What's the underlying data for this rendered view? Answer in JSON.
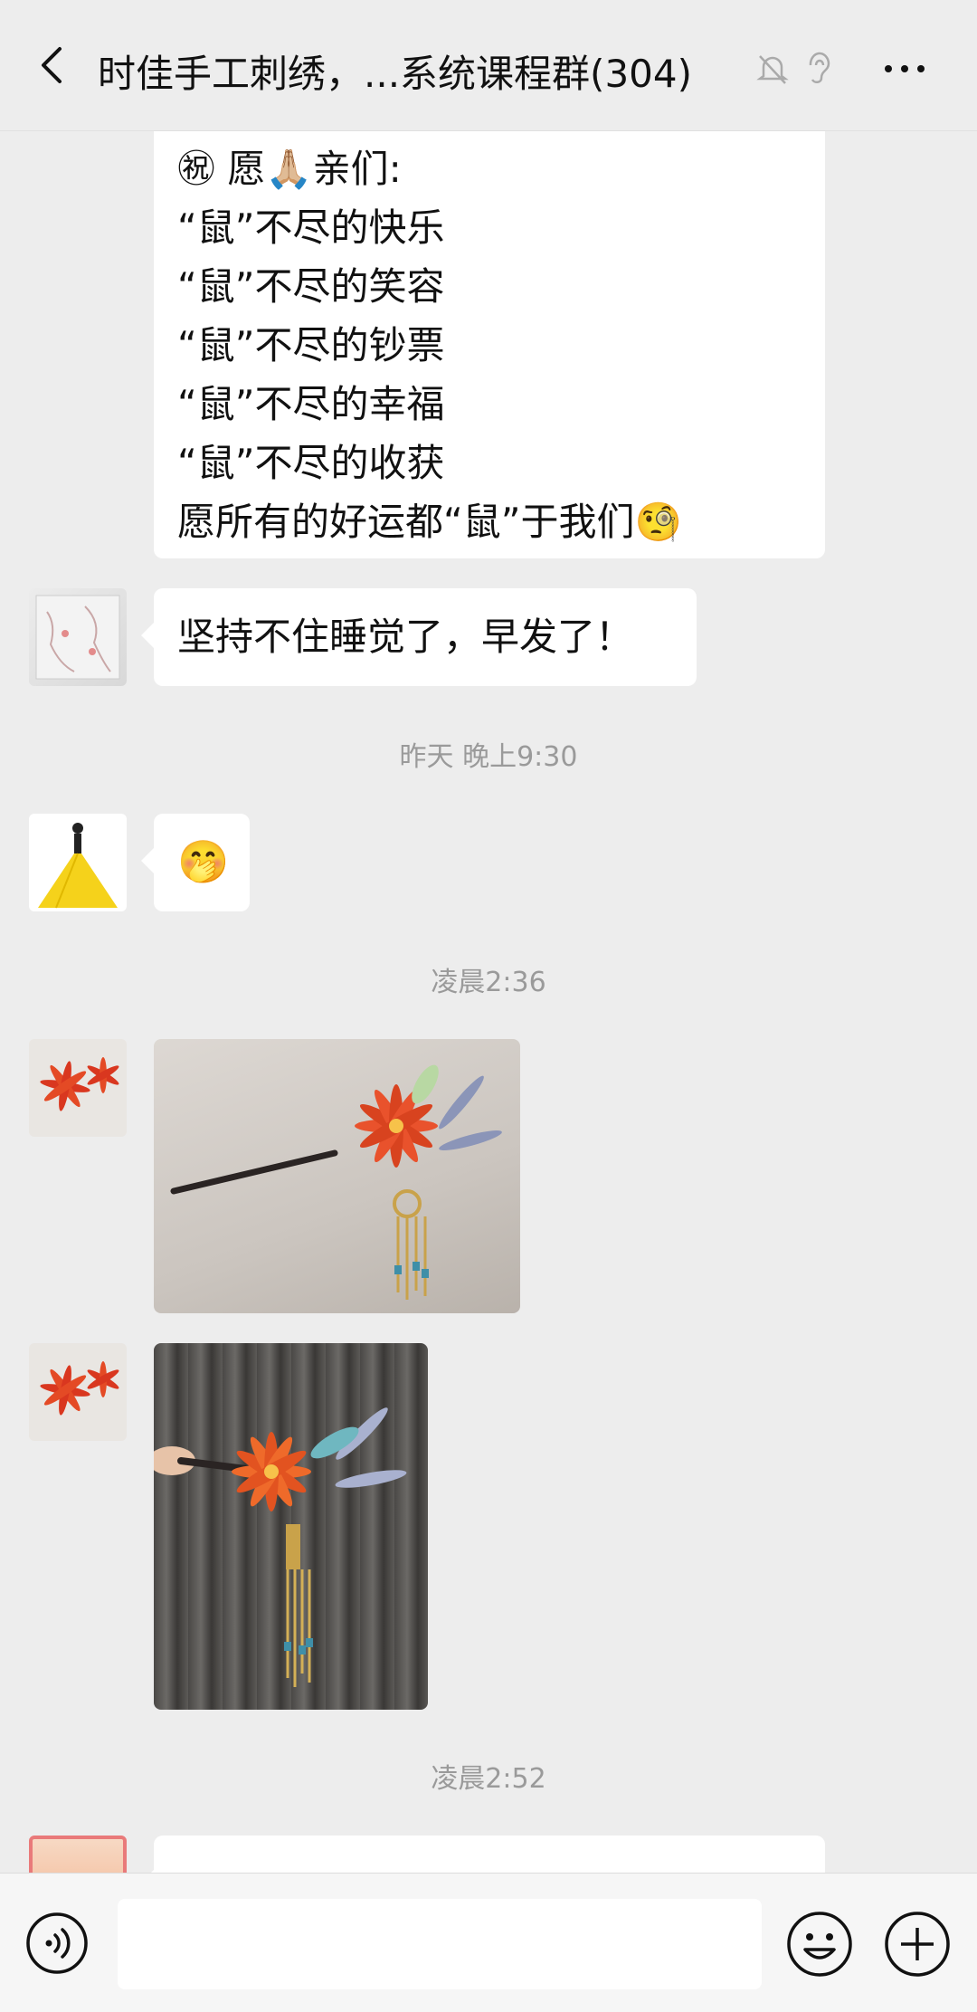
{
  "header": {
    "title": "时佳手工刺绣，...系统课程群(304)",
    "back_icon": "chevron-left-icon",
    "mute_icon": "bell-off-icon",
    "earpiece_icon": "ear-icon",
    "more_icon": "more-horizontal-icon"
  },
  "messages": {
    "greeting_lines": [
      "㊗ 愿🙏🏼亲们:",
      "“鼠”不尽的快乐",
      "“鼠”不尽的笑容",
      "“鼠”不尽的钞票",
      "“鼠”不尽的幸福",
      "“鼠”不尽的收获",
      "愿所有的好运都“鼠”于我们🧐"
    ],
    "sleep_text": "坚持不住睡觉了，早发了！",
    "time_1": "昨天 晚上9:30",
    "emoji_text": "🤭",
    "time_2": "凌晨2:36",
    "time_3": "凌晨2:52",
    "partial_text": "…"
  },
  "input": {
    "voice_icon": "voice-icon",
    "emoji_icon": "smile-icon",
    "plus_icon": "plus-circle-icon"
  },
  "colors": {
    "background": "#ededed",
    "bubble": "#ffffff",
    "time_text": "#9a9a9a"
  }
}
